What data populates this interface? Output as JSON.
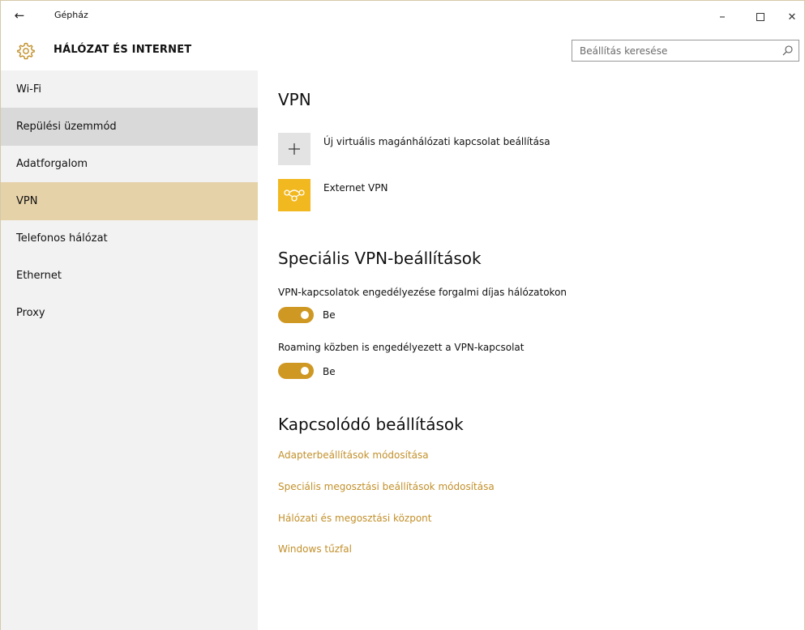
{
  "window": {
    "title": "Gépház",
    "back_icon": "←",
    "minimize_icon": "–",
    "close_icon": "✕"
  },
  "header": {
    "title": "HÁLÓZAT ÉS INTERNET",
    "search_placeholder": "Beállítás keresése",
    "accent_color": "#c2902a"
  },
  "sidebar": {
    "items": [
      {
        "label": "Wi-Fi",
        "state": "normal"
      },
      {
        "label": "Repülési üzemmód",
        "state": "hover"
      },
      {
        "label": "Adatforgalom",
        "state": "normal"
      },
      {
        "label": "VPN",
        "state": "selected"
      },
      {
        "label": "Telefonos hálózat",
        "state": "normal"
      },
      {
        "label": "Ethernet",
        "state": "normal"
      },
      {
        "label": "Proxy",
        "state": "normal"
      }
    ]
  },
  "main": {
    "vpn_heading": "VPN",
    "add_vpn_label": "Új virtuális magánhálózati kapcsolat beállítása",
    "vpn_connection_name": "Externet VPN",
    "advanced_heading": "Speciális VPN-beállítások",
    "options": [
      {
        "label": "VPN-kapcsolatok engedélyezése forgalmi díjas hálózatokon",
        "toggle": "Be",
        "on": true
      },
      {
        "label": "Roaming közben is engedélyezett a VPN-kapcsolat",
        "toggle": "Be",
        "on": true
      }
    ],
    "related_heading": "Kapcsolódó beállítások",
    "links": [
      "Adapterbeállítások módosítása",
      "Speciális megosztási beállítások módosítása",
      "Hálózati és megosztási központ",
      "Windows tűzfal"
    ]
  },
  "colors": {
    "selected_nav": "#e6d2a9",
    "hover_nav": "#d9d9d9",
    "sidebar_bg": "#f2f2f2",
    "toggle_on": "#cf9823",
    "vpn_tile": "#f2b81f"
  }
}
